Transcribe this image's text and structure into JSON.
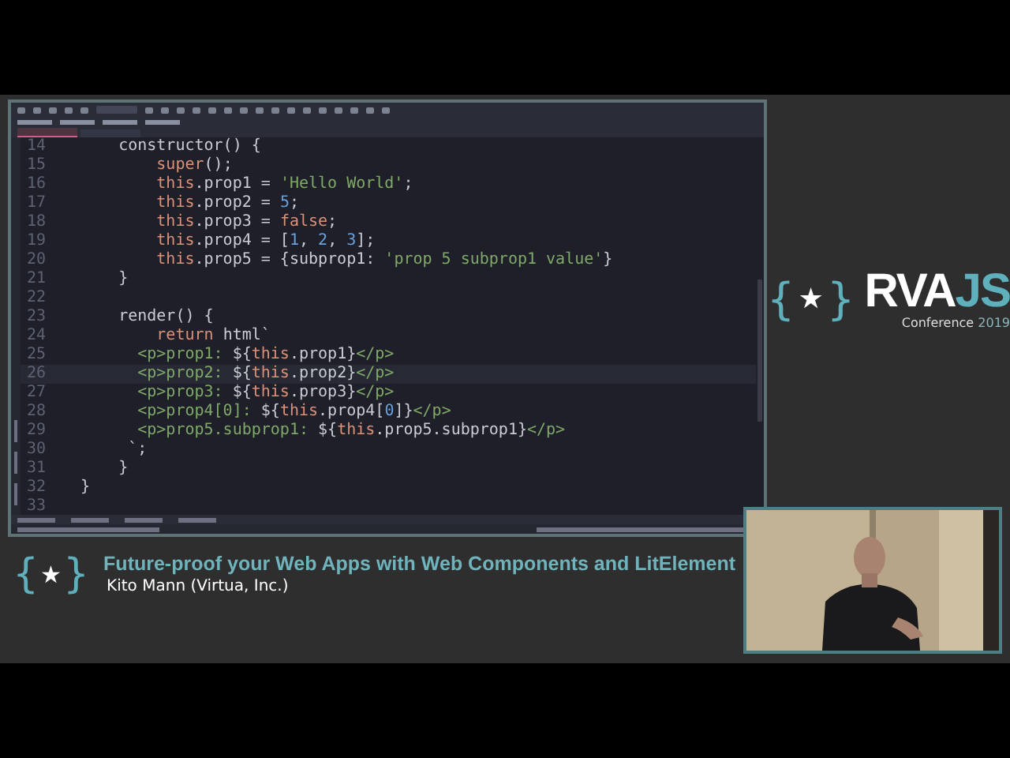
{
  "editor": {
    "lines": [
      {
        "number": "14",
        "current": false,
        "tokens": [
          {
            "kind": "plain",
            "text": "    constructor() {"
          }
        ]
      },
      {
        "number": "15",
        "current": false,
        "tokens": [
          {
            "kind": "keyword",
            "text": "        super"
          },
          {
            "kind": "plain",
            "text": "();"
          }
        ]
      },
      {
        "number": "16",
        "current": false,
        "tokens": [
          {
            "kind": "keyword",
            "text": "        this"
          },
          {
            "kind": "plain",
            "text": ".prop1 = "
          },
          {
            "kind": "string",
            "text": "'Hello World'"
          },
          {
            "kind": "plain",
            "text": ";"
          }
        ]
      },
      {
        "number": "17",
        "current": false,
        "tokens": [
          {
            "kind": "keyword",
            "text": "        this"
          },
          {
            "kind": "plain",
            "text": ".prop2 = "
          },
          {
            "kind": "number",
            "text": "5"
          },
          {
            "kind": "plain",
            "text": ";"
          }
        ]
      },
      {
        "number": "18",
        "current": false,
        "tokens": [
          {
            "kind": "keyword",
            "text": "        this"
          },
          {
            "kind": "plain",
            "text": ".prop3 = "
          },
          {
            "kind": "keyword",
            "text": "false"
          },
          {
            "kind": "plain",
            "text": ";"
          }
        ]
      },
      {
        "number": "19",
        "current": false,
        "tokens": [
          {
            "kind": "keyword",
            "text": "        this"
          },
          {
            "kind": "plain",
            "text": ".prop4 = ["
          },
          {
            "kind": "number",
            "text": "1"
          },
          {
            "kind": "plain",
            "text": ", "
          },
          {
            "kind": "number",
            "text": "2"
          },
          {
            "kind": "plain",
            "text": ", "
          },
          {
            "kind": "number",
            "text": "3"
          },
          {
            "kind": "plain",
            "text": "];"
          }
        ]
      },
      {
        "number": "20",
        "current": false,
        "tokens": [
          {
            "kind": "keyword",
            "text": "        this"
          },
          {
            "kind": "plain",
            "text": ".prop5 = {subprop1: "
          },
          {
            "kind": "string",
            "text": "'prop 5 subprop1 value'"
          },
          {
            "kind": "plain",
            "text": "}"
          }
        ]
      },
      {
        "number": "21",
        "current": false,
        "tokens": [
          {
            "kind": "plain",
            "text": "    }"
          }
        ]
      },
      {
        "number": "22",
        "current": false
      },
      {
        "number": "23",
        "current": false,
        "tokens": [
          {
            "kind": "plain",
            "text": "    render() {"
          }
        ]
      },
      {
        "number": "24",
        "current": false,
        "tokens": [
          {
            "kind": "keyword",
            "text": "        return"
          },
          {
            "kind": "plain",
            "text": " html`"
          }
        ]
      },
      {
        "number": "25",
        "current": false,
        "tokens": [
          {
            "kind": "string",
            "text": "      <p>prop1: "
          },
          {
            "kind": "plain",
            "text": "${"
          },
          {
            "kind": "keyword",
            "text": "this"
          },
          {
            "kind": "plain",
            "text": ".prop1}"
          },
          {
            "kind": "string",
            "text": "</p>"
          }
        ]
      },
      {
        "number": "26",
        "current": true,
        "tokens": [
          {
            "kind": "string",
            "text": "      <p>prop2: "
          },
          {
            "kind": "plain",
            "text": "${"
          },
          {
            "kind": "keyword",
            "text": "this"
          },
          {
            "kind": "plain",
            "text": ".prop2}"
          },
          {
            "kind": "string",
            "text": "</p>"
          }
        ]
      },
      {
        "number": "27",
        "current": false,
        "tokens": [
          {
            "kind": "string",
            "text": "      <p>prop3: "
          },
          {
            "kind": "plain",
            "text": "${"
          },
          {
            "kind": "keyword",
            "text": "this"
          },
          {
            "kind": "plain",
            "text": ".prop3}"
          },
          {
            "kind": "string",
            "text": "</p>"
          }
        ]
      },
      {
        "number": "28",
        "current": false,
        "tokens": [
          {
            "kind": "string",
            "text": "      <p>prop4[0]: "
          },
          {
            "kind": "plain",
            "text": "${"
          },
          {
            "kind": "keyword",
            "text": "this"
          },
          {
            "kind": "plain",
            "text": ".prop4["
          },
          {
            "kind": "number",
            "text": "0"
          },
          {
            "kind": "plain",
            "text": "]}"
          },
          {
            "kind": "string",
            "text": "</p>"
          }
        ]
      },
      {
        "number": "29",
        "current": false,
        "tokens": [
          {
            "kind": "string",
            "text": "      <p>prop5.subprop1: "
          },
          {
            "kind": "plain",
            "text": "${"
          },
          {
            "kind": "keyword",
            "text": "this"
          },
          {
            "kind": "plain",
            "text": ".prop5.subprop1}"
          },
          {
            "kind": "string",
            "text": "</p>"
          }
        ]
      },
      {
        "number": "30",
        "current": false,
        "tokens": [
          {
            "kind": "plain",
            "text": "     `;"
          }
        ]
      },
      {
        "number": "31",
        "current": false,
        "tokens": [
          {
            "kind": "plain",
            "text": "    }"
          }
        ]
      },
      {
        "number": "32",
        "current": false,
        "tokens": [
          {
            "kind": "plain",
            "text": "}"
          }
        ]
      },
      {
        "number": "33",
        "current": false
      }
    ]
  },
  "logo": {
    "brace_open": "{",
    "star": "★",
    "brace_close": "}",
    "name": "RVA",
    "name_accent": "JS",
    "subtitle": "Conference",
    "year": "2019"
  },
  "banner": {
    "brace_open": "{",
    "star": "★",
    "brace_close": "}",
    "title": "Future-proof your Web Apps with Web Components and LitElement",
    "speaker": "Kito Mann (Virtua, Inc.)"
  }
}
